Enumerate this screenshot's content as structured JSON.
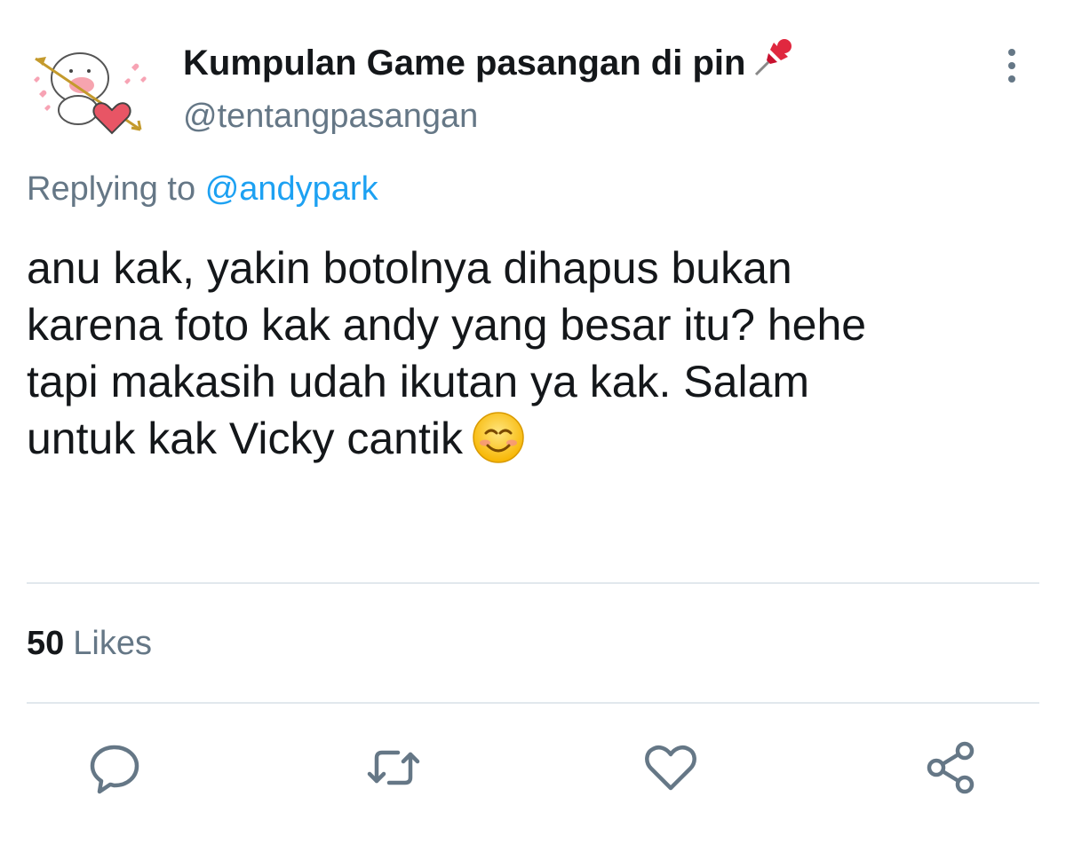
{
  "author": {
    "display_name": "Kumpulan Game pasangan di pin",
    "handle": "@tentangpasangan",
    "avatar_icon": "cartoon-heart-arrow-avatar",
    "name_emoji_icon": "pushpin-icon"
  },
  "reply": {
    "prefix": "Replying to",
    "mention": "@andypark"
  },
  "tweet": {
    "lines": [
      "anu kak, yakin botolnya dihapus bukan",
      "karena foto kak andy yang besar itu? hehe",
      "tapi makasih udah ikutan ya kak. Salam",
      "untuk kak Vicky cantik"
    ],
    "trailing_emoji_icon": "smiling-face-icon"
  },
  "stats": {
    "likes_count": "50",
    "likes_label": "Likes"
  },
  "actions": [
    "reply-icon",
    "retweet-icon",
    "like-icon",
    "share-icon"
  ],
  "colors": {
    "text": "#14171a",
    "secondary": "#657786",
    "link": "#1da1f2",
    "divider": "#e1e8ed",
    "icon": "#657786"
  }
}
